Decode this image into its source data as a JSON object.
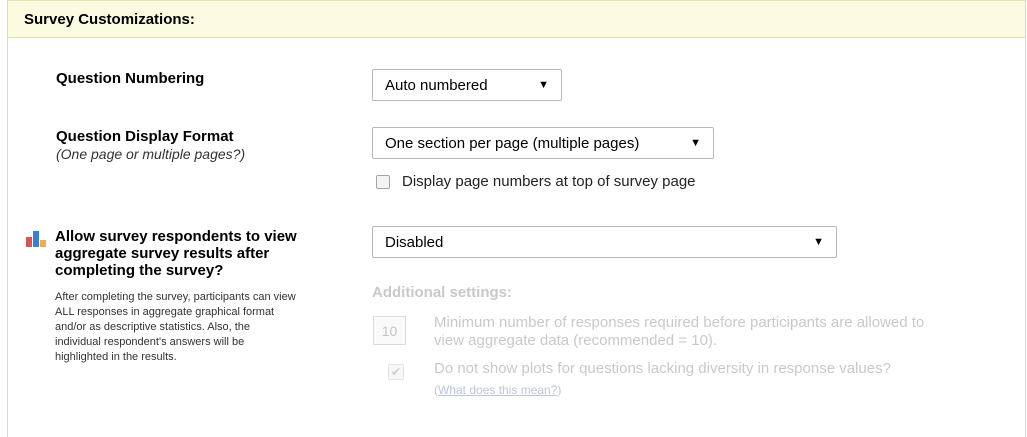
{
  "header": {
    "title": "Survey Customizations:"
  },
  "question_numbering": {
    "label": "Question Numbering",
    "select_value": "Auto numbered"
  },
  "display_format": {
    "label": "Question Display Format",
    "sublabel": "(One page or multiple pages?)",
    "select_value": "One section per page (multiple pages)",
    "checkbox_label": "Display page numbers at top of survey page",
    "checkbox_checked": false
  },
  "aggregate": {
    "icon": "bar-chart-icon",
    "label_lines": [
      "Allow survey respondents to view",
      "aggregate survey results after",
      "completing the survey?"
    ],
    "description_lines": [
      "After completing the survey, participants can view",
      "ALL responses in aggregate graphical format",
      "and/or as descriptive statistics. Also, the",
      "individual respondent's answers will be",
      "highlighted in the results."
    ],
    "select_value": "Disabled",
    "additional_heading": "Additional settings:",
    "min_responses_value": "10",
    "min_responses_lines": [
      "Minimum number of responses required before participants are allowed to",
      "view aggregate data (recommended = 10)."
    ],
    "diversity_checked": true,
    "diversity_label": "Do not show plots for questions lacking diversity in response values?",
    "diversity_link_prefix": "(",
    "diversity_link": "What does this mean?",
    "diversity_link_suffix": ")"
  },
  "colors": {
    "header_bg": "#fbfbe2",
    "disabled_text": "#c9c9c9",
    "icon_red": "#d9534f",
    "icon_blue": "#3b7fd4"
  }
}
